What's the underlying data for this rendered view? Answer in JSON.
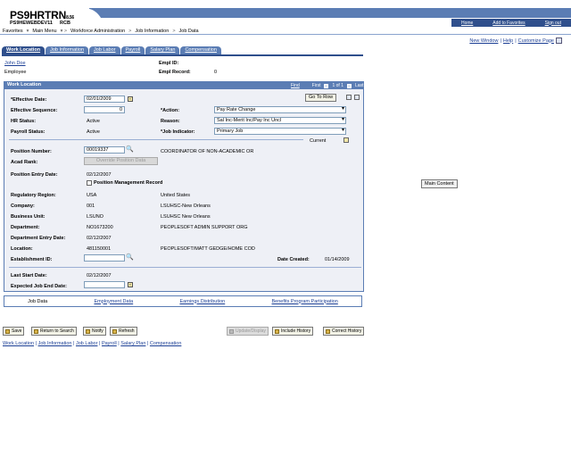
{
  "brand": {
    "title": "PS9HRTRN",
    "version": "8.56",
    "db": "PS9HEWEBDEV11",
    "user": "RCB"
  },
  "top_links": [
    "Home",
    "Add to Favorites",
    "Sign out"
  ],
  "menu": {
    "favorites": "Favorites",
    "main_menu": "Main Menu",
    "crumbs": [
      "Workforce Administration",
      "Job Information",
      "Job Data"
    ]
  },
  "sub_links": {
    "new_window": "New Window",
    "help": "Help",
    "customize": "Customize Page"
  },
  "tabs": [
    "Work Location",
    "Job Information",
    "Job Labor",
    "Payroll",
    "Salary Plan",
    "Compensation"
  ],
  "employee": {
    "name": "John Doe",
    "type": "Employee",
    "empl_id_label": "Empl ID:",
    "empl_id": "",
    "empl_record_label": "Empl Record:",
    "empl_record": "0"
  },
  "panel": {
    "title": "Work Location",
    "find": "Find",
    "first": "First",
    "count": "1 of 1",
    "last": "Last",
    "go_to_row": "Go To Row",
    "effective_date_label": "*Effective Date:",
    "effective_date": "02/01/2009",
    "effective_seq_label": "Effective Sequence:",
    "effective_seq": "0",
    "action_label": "*Action:",
    "action": "Pay Rate Change",
    "hr_status_label": "HR Status:",
    "hr_status": "Active",
    "reason_label": "Reason:",
    "reason": "Sal Inc-Merit Inc/Pay Inc Uncl",
    "payroll_status_label": "Payroll Status:",
    "payroll_status": "Active",
    "job_indicator_label": "*Job Indicator:",
    "job_indicator": "Primary Job",
    "current": "Current",
    "position_number_label": "Position Number:",
    "position_number": "00019337",
    "position_desc": "COORDINATOR OF NON-ACADEMIC OR",
    "acad_rank_label": "Acad Rank:",
    "acad_rank_button": "Override Position Data",
    "position_entry_label": "Position Entry Date:",
    "position_entry": "02/12/2007",
    "position_mgmt": "Position Management Record",
    "regulatory_label": "Regulatory Region:",
    "regulatory": "USA",
    "regulatory_desc": "United States",
    "company_label": "Company:",
    "company": "001",
    "company_desc": "LSUHSC-New Orleans",
    "business_unit_label": "Business Unit:",
    "business_unit": "LSUNO",
    "business_unit_desc": "LSUHSC New Orleans",
    "department_label": "Department:",
    "department": "NO1673200",
    "department_desc": "PEOPLESOFT ADMIN SUPPORT ORG",
    "dept_entry_label": "Department Entry Date:",
    "dept_entry": "02/12/2007",
    "location_label": "Location:",
    "location": "481150001",
    "location_desc": "PEOPLESOFT/MATT GEDGE/HOME COD",
    "establishment_label": "Establishment ID:",
    "establishment": "",
    "date_created_label": "Date Created:",
    "date_created": "01/14/2009",
    "last_start_label": "Last Start Date:",
    "last_start": "02/12/2007",
    "expected_end_label": "Expected Job End Date:",
    "expected_end": ""
  },
  "job_tabs": [
    "Job Data",
    "Employment Data",
    "Earnings Distribution",
    "Benefits Program Participation"
  ],
  "actions": [
    "Save",
    "Return to Search",
    "Notify",
    "Refresh",
    "Update/Display",
    "Include History",
    "Correct History"
  ],
  "footer_links": [
    "Work Location",
    "Job Information",
    "Job Labor",
    "Payroll",
    "Salary Plan",
    "Compensation"
  ],
  "tooltip": "Main Content"
}
